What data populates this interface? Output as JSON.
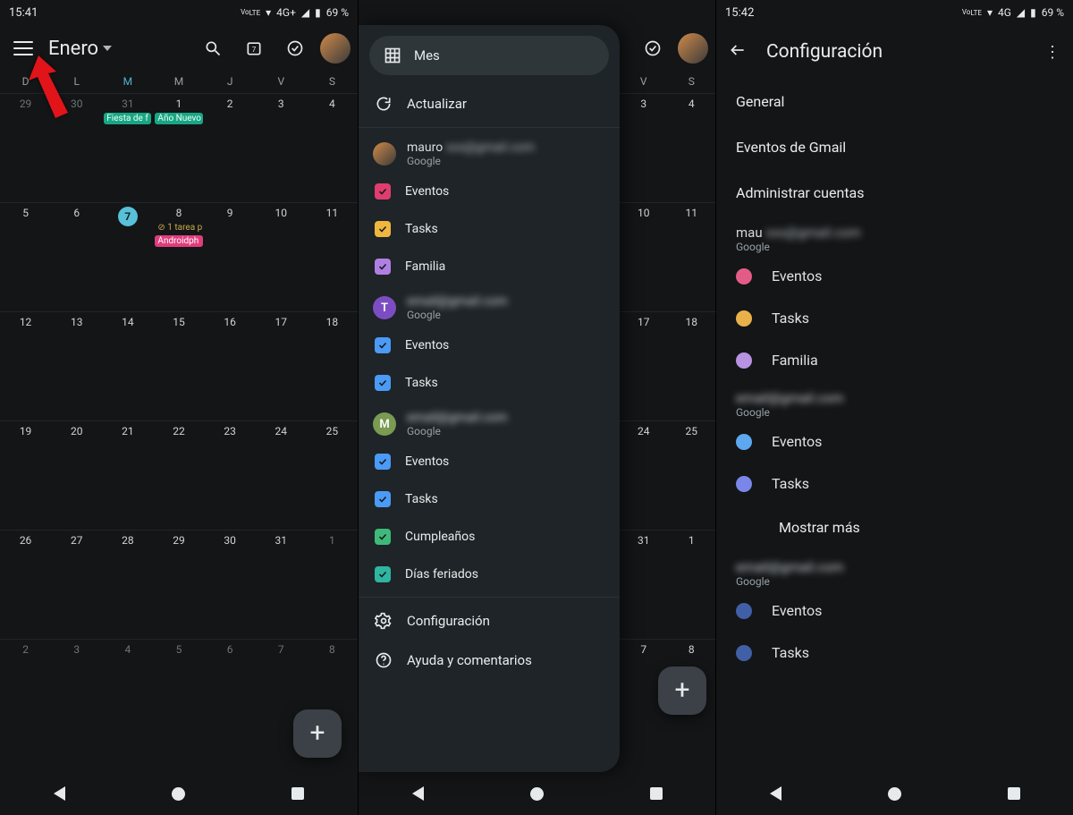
{
  "status": {
    "time1": "15:41",
    "time2": "15:42",
    "time3": "15:42",
    "net": "4G+",
    "net3": "4G",
    "batt": "69 %",
    "lte": "LTE",
    "volte": "Vo"
  },
  "panel1": {
    "month": "Enero",
    "dow": [
      "D",
      "L",
      "M",
      "M",
      "J",
      "V",
      "S"
    ],
    "today_index": 2,
    "cells": [
      {
        "n": "29",
        "dim": true
      },
      {
        "n": "30",
        "dim": true
      },
      {
        "n": "31",
        "dim": true,
        "evt": [
          {
            "t": "Fiesta de f",
            "c": "green"
          }
        ]
      },
      {
        "n": "1",
        "evt": [
          {
            "t": "Año Nuevo",
            "c": "green"
          }
        ]
      },
      {
        "n": "2"
      },
      {
        "n": "3"
      },
      {
        "n": "4"
      },
      {
        "n": "5"
      },
      {
        "n": "6"
      },
      {
        "n": "7",
        "today": true
      },
      {
        "n": "8",
        "evt": [
          {
            "t": "⊘ 1 tarea p",
            "c": "task"
          },
          {
            "t": "Androidph",
            "c": "pink"
          }
        ]
      },
      {
        "n": "9"
      },
      {
        "n": "10"
      },
      {
        "n": "11"
      },
      {
        "n": "12"
      },
      {
        "n": "13"
      },
      {
        "n": "14"
      },
      {
        "n": "15"
      },
      {
        "n": "16"
      },
      {
        "n": "17"
      },
      {
        "n": "18"
      },
      {
        "n": "19"
      },
      {
        "n": "20"
      },
      {
        "n": "21"
      },
      {
        "n": "22"
      },
      {
        "n": "23"
      },
      {
        "n": "24"
      },
      {
        "n": "25"
      },
      {
        "n": "26"
      },
      {
        "n": "27"
      },
      {
        "n": "28"
      },
      {
        "n": "29"
      },
      {
        "n": "30"
      },
      {
        "n": "31"
      },
      {
        "n": "1",
        "dim": true
      },
      {
        "n": "2",
        "dim": true
      },
      {
        "n": "3",
        "dim": true
      },
      {
        "n": "4",
        "dim": true
      },
      {
        "n": "5",
        "dim": true
      },
      {
        "n": "6",
        "dim": true
      },
      {
        "n": "7",
        "dim": true
      },
      {
        "n": "8",
        "dim": true
      }
    ]
  },
  "panel2": {
    "view_pill": "Mes",
    "refresh": "Actualizar",
    "accounts": [
      {
        "avatar": "img",
        "email": "mauro",
        "prov": "Google",
        "cals": [
          {
            "c": "red",
            "l": "Eventos"
          },
          {
            "c": "yellow",
            "l": "Tasks"
          },
          {
            "c": "purple",
            "l": "Familia"
          }
        ]
      },
      {
        "avatar": "T",
        "email": "",
        "prov": "Google",
        "cals": [
          {
            "c": "blue",
            "l": "Eventos"
          },
          {
            "c": "blue",
            "l": "Tasks"
          }
        ]
      },
      {
        "avatar": "M",
        "email": "",
        "prov": "Google",
        "cals": [
          {
            "c": "blue",
            "l": "Eventos"
          },
          {
            "c": "blue",
            "l": "Tasks"
          }
        ]
      }
    ],
    "extras": [
      {
        "c": "green",
        "l": "Cumpleaños"
      },
      {
        "c": "teal",
        "l": "Días feriados"
      }
    ],
    "settings": "Configuración",
    "help": "Ayuda y comentarios",
    "right_dow": [
      "V",
      "S"
    ],
    "right_cells": [
      [
        "3",
        "4"
      ],
      [
        "10",
        "11"
      ],
      [
        "17",
        "18"
      ],
      [
        "24",
        "25"
      ],
      [
        "31",
        "1"
      ],
      [
        "7",
        "8"
      ]
    ]
  },
  "panel3": {
    "title": "Configuración",
    "items": [
      "General",
      "Eventos de Gmail",
      "Administrar cuentas"
    ],
    "sections": [
      {
        "email": "mau",
        "prov": "Google",
        "rows": [
          {
            "c": "pink",
            "l": "Eventos"
          },
          {
            "c": "orange",
            "l": "Tasks"
          },
          {
            "c": "lav",
            "l": "Familia"
          }
        ]
      },
      {
        "email": "",
        "prov": "Google",
        "rows": [
          {
            "c": "blue",
            "l": "Eventos"
          },
          {
            "c": "indigo",
            "l": "Tasks"
          }
        ],
        "more": "Mostrar más"
      },
      {
        "email": "",
        "prov": "Google",
        "rows": [
          {
            "c": "navy",
            "l": "Eventos"
          },
          {
            "c": "navy",
            "l": "Tasks"
          }
        ]
      }
    ]
  }
}
